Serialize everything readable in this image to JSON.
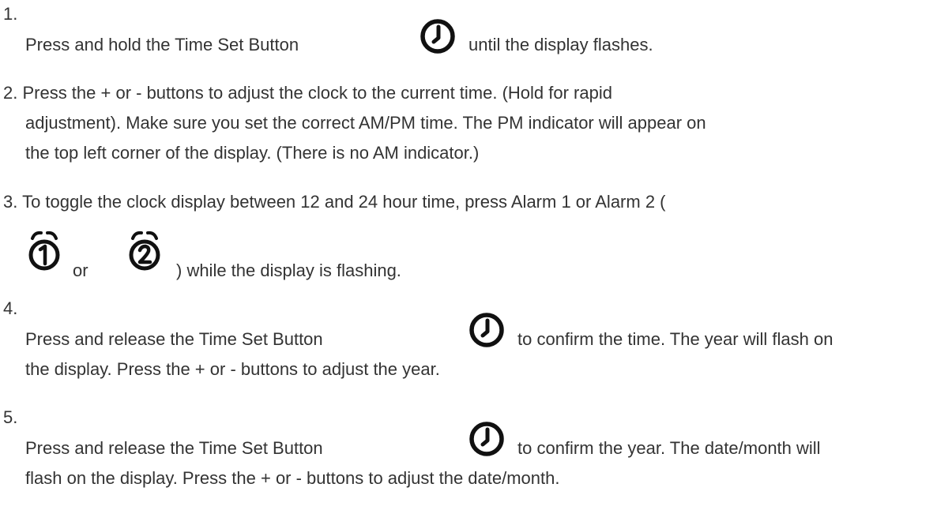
{
  "steps": [
    {
      "number": "1.",
      "before_icon": "Press and hold the Time Set Button",
      "icon": "clock-icon",
      "after_icon": "until the display flashes."
    },
    {
      "lines": [
        "2. Press the + or - buttons to adjust the clock to the current time. (Hold for rapid",
        "adjustment). Make sure you set the correct AM/PM time. The PM indicator will appear on",
        "the top left corner of the display. (There is no AM indicator.)"
      ]
    },
    {
      "line1": "3. To toggle the clock display between 12 and 24 hour time, press Alarm 1 or Alarm 2 (",
      "icon_a": "alarm-1-icon",
      "or_text": "or",
      "icon_b": "alarm-2-icon",
      "after_icons": ") while the display is flashing."
    },
    {
      "number": "4.",
      "before_icon": "Press and release the Time Set Button",
      "icon": "clock-icon",
      "after_icon": "to confirm the time. The year will flash on",
      "line2": "the display. Press the + or - buttons to adjust the year."
    },
    {
      "number": "5.",
      "before_icon": "Press and release the Time Set Button",
      "icon": "clock-icon",
      "after_icon": "to confirm the year. The date/month will",
      "line2": "flash on the display. Press the + or - buttons to adjust the date/month."
    }
  ]
}
